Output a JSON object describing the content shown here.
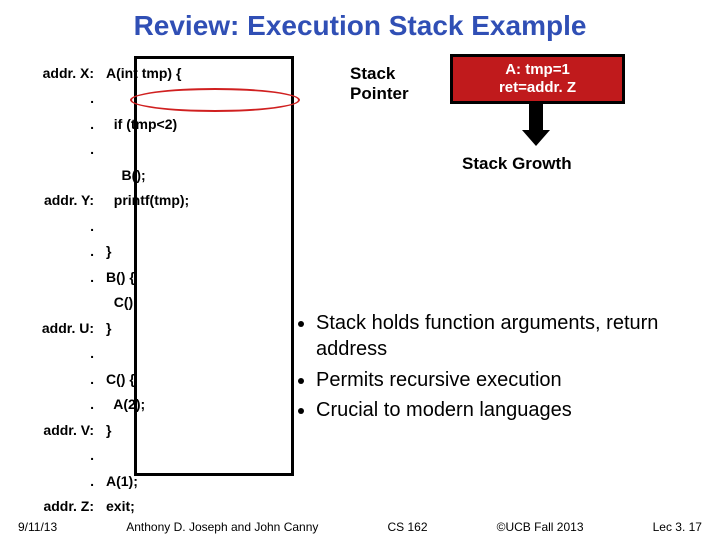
{
  "title": "Review: Execution Stack Example",
  "code": {
    "rows": [
      {
        "addr": "addr. X:",
        "text": "A(int tmp) {"
      },
      {
        "addr": ".",
        "text": ""
      },
      {
        "addr": ".",
        "text": "  if (tmp<2)"
      },
      {
        "addr": ".",
        "text": ""
      },
      {
        "addr": "",
        "text": "    B();"
      },
      {
        "addr": "addr. Y:",
        "text": "  printf(tmp);"
      },
      {
        "addr": ".",
        "text": ""
      },
      {
        "addr": ".",
        "text": "}"
      },
      {
        "addr": ".",
        "text": "B() {"
      },
      {
        "addr": "",
        "text": "  C();"
      },
      {
        "addr": "addr. U:",
        "text": "}"
      },
      {
        "addr": ".",
        "text": ""
      },
      {
        "addr": ".",
        "text": "C() {"
      },
      {
        "addr": ".",
        "text": "  A(2);"
      },
      {
        "addr": "addr. V:",
        "text": "}"
      },
      {
        "addr": ".",
        "text": ""
      },
      {
        "addr": ".",
        "text": "A(1);"
      },
      {
        "addr": "addr. Z:",
        "text": "exit;"
      }
    ]
  },
  "stack_pointer_label_line1": "Stack",
  "stack_pointer_label_line2": "Pointer",
  "frame_a_line1": "A: tmp=1",
  "frame_a_line2": "ret=addr. Z",
  "growth_label": "Stack Growth",
  "bullets": [
    "Stack holds function arguments, return address",
    "Permits recursive execution",
    "Crucial to modern languages"
  ],
  "footer": {
    "date": "9/11/13",
    "authors": "Anthony D. Joseph and John Canny",
    "course": "CS 162",
    "copyright": "©UCB Fall 2013",
    "lec": "Lec 3. 17"
  }
}
